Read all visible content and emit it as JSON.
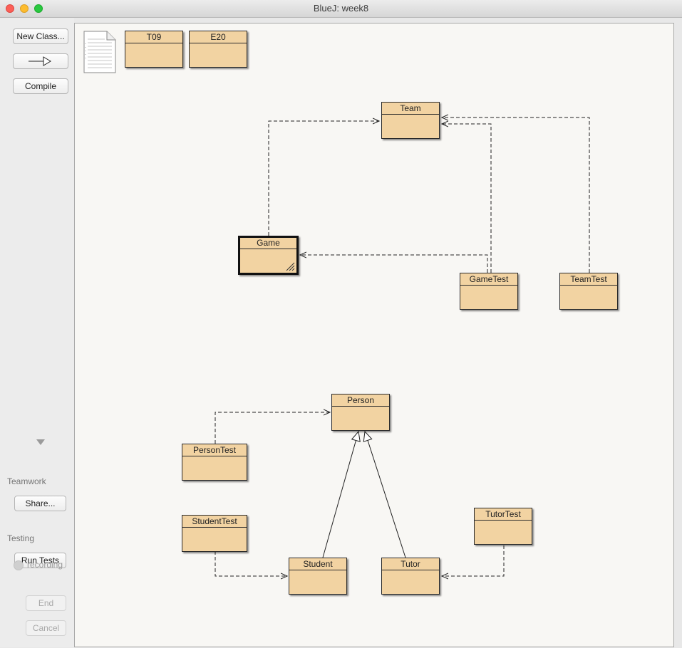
{
  "window": {
    "title": "BlueJ:  week8"
  },
  "toolbar": {
    "new_class_label": "New Class...",
    "arrow_label": "—▷",
    "compile_label": "Compile"
  },
  "teamwork": {
    "label": "Teamwork",
    "share_label": "Share..."
  },
  "testing": {
    "label": "Testing",
    "run_tests_label": "Run Tests",
    "recording_label": "recording",
    "end_label": "End",
    "cancel_label": "Cancel"
  },
  "diagram": {
    "readme_icon": "readme-document-icon",
    "classes": {
      "t09": "T09",
      "e20": "E20",
      "team": "Team",
      "game": "Game",
      "game_test": "GameTest",
      "team_test": "TeamTest",
      "person": "Person",
      "person_test": "PersonTest",
      "student_test": "StudentTest",
      "student": "Student",
      "tutor": "Tutor",
      "tutor_test": "TutorTest"
    }
  },
  "colors": {
    "class_fill": "#f2d3a2",
    "canvas_bg": "#f8f7f4"
  }
}
